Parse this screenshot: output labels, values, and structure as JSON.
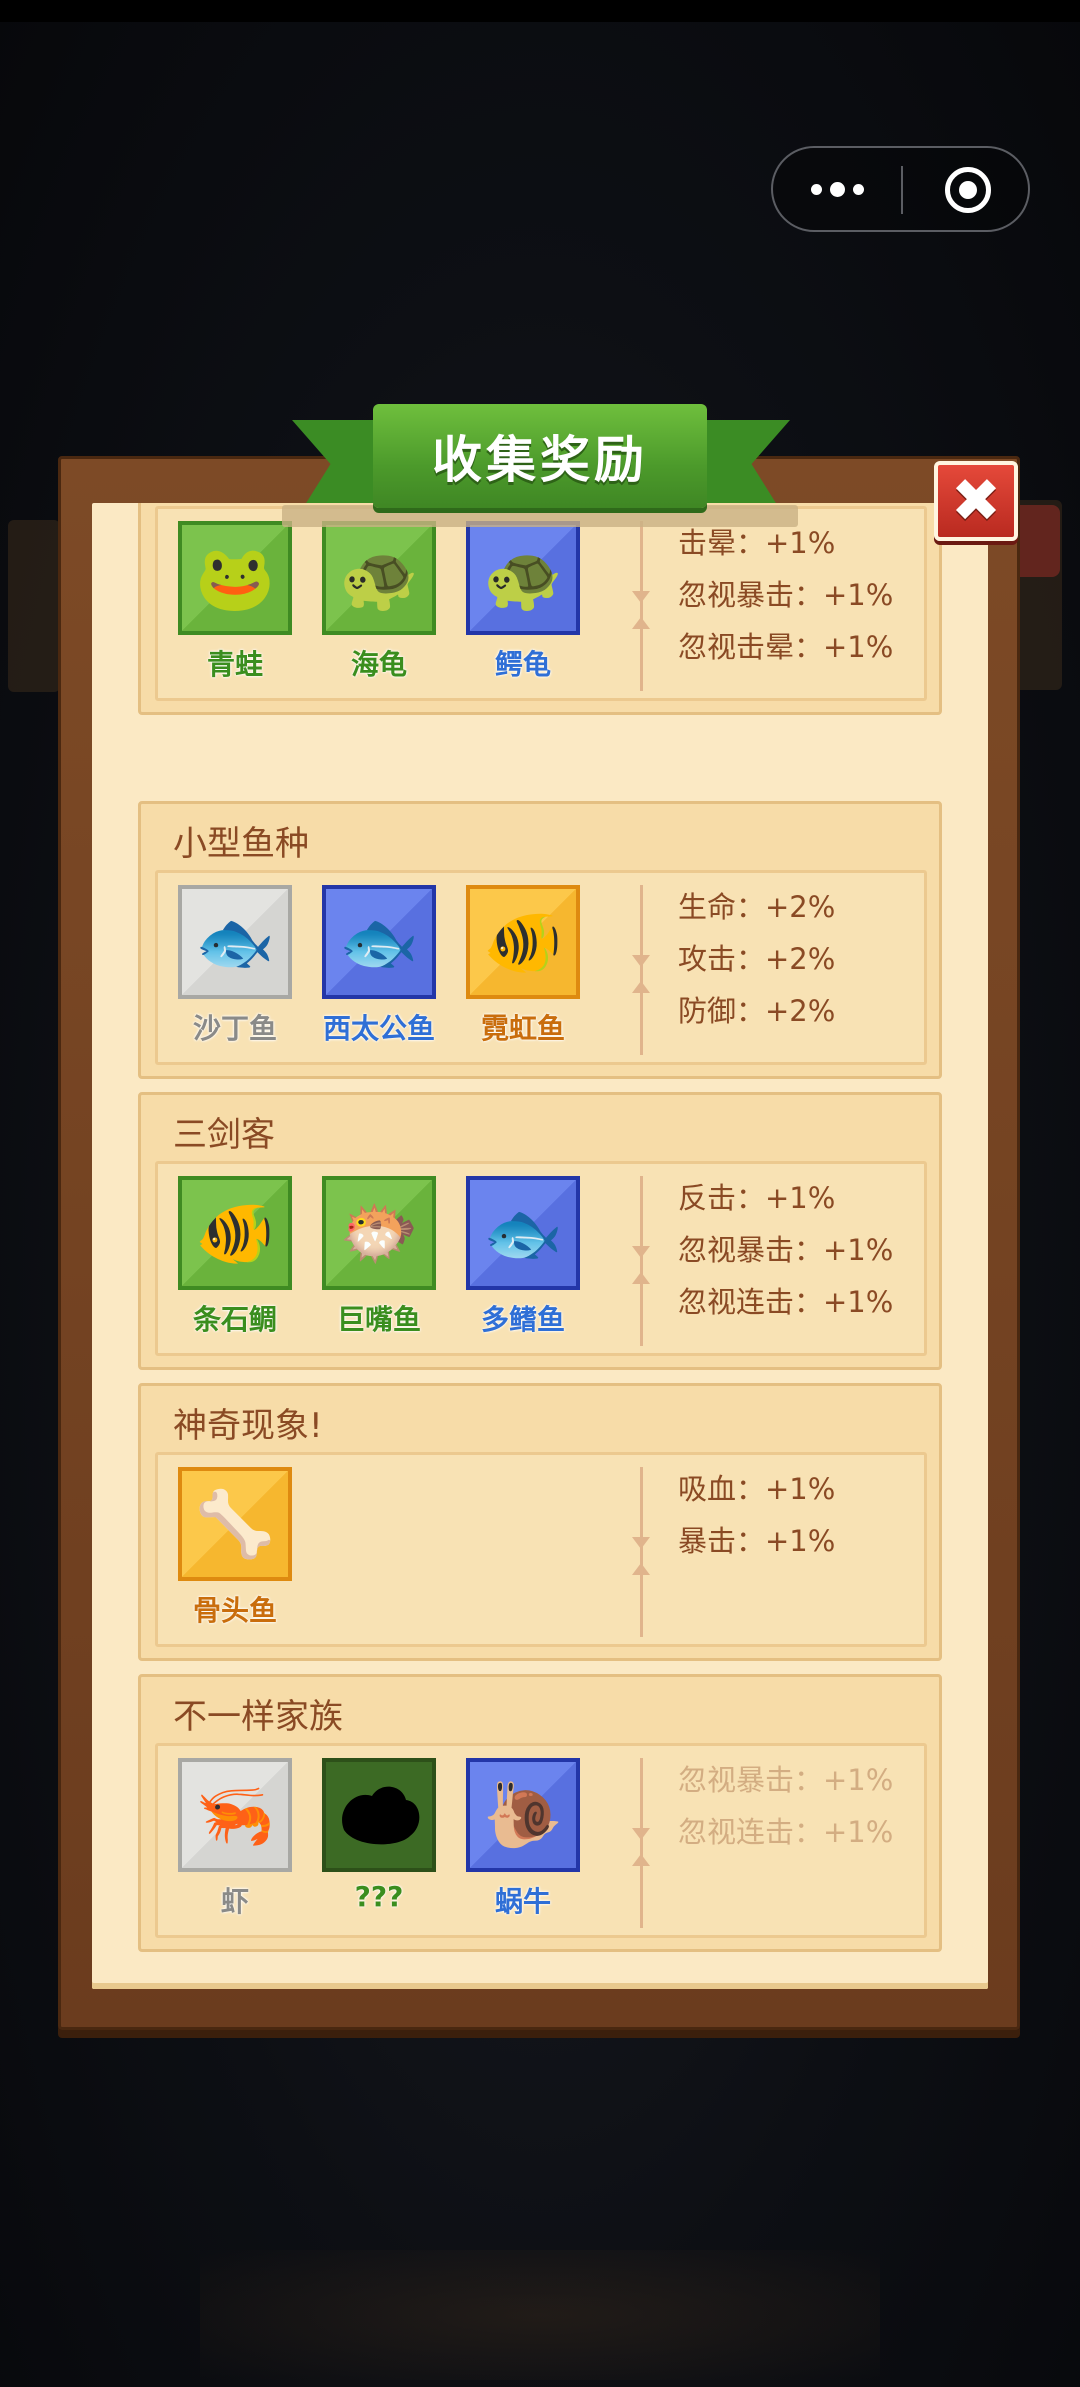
{
  "window": {
    "capsule_more": "more-dots",
    "capsule_close": "target-circle"
  },
  "panel": {
    "title": "收集奖励",
    "close_label": "✖"
  },
  "groups": [
    {
      "title": "",
      "items": [
        {
          "name": "青蛙",
          "rarity": "green",
          "icon": "frog-icon",
          "glyph": "🐸"
        },
        {
          "name": "海龟",
          "rarity": "green",
          "icon": "turtle-icon",
          "glyph": "🐢"
        },
        {
          "name": "鳄龟",
          "rarity": "blue",
          "icon": "snapping-turtle-icon",
          "glyph": "🐢"
        }
      ],
      "stats": [
        "击晕：+1%",
        "忽视暴击：+1%",
        "忽视击晕：+1%"
      ],
      "active": true
    },
    {
      "title": "小型鱼种",
      "items": [
        {
          "name": "沙丁鱼",
          "rarity": "gray",
          "icon": "sardine-icon",
          "glyph": "🐟"
        },
        {
          "name": "西太公鱼",
          "rarity": "blue",
          "icon": "smelt-icon",
          "glyph": "🐟"
        },
        {
          "name": "霓虹鱼",
          "rarity": "gold",
          "icon": "neon-fish-icon",
          "glyph": "🐠"
        }
      ],
      "stats": [
        "生命：+2%",
        "攻击：+2%",
        "防御：+2%"
      ],
      "active": true
    },
    {
      "title": "三剑客",
      "items": [
        {
          "name": "条石鲷",
          "rarity": "green",
          "icon": "striped-beakfish-icon",
          "glyph": "🐠"
        },
        {
          "name": "巨嘴鱼",
          "rarity": "green",
          "icon": "bigmouth-fish-icon",
          "glyph": "🐡"
        },
        {
          "name": "多鳍鱼",
          "rarity": "blue",
          "icon": "bichir-icon",
          "glyph": "🐟"
        }
      ],
      "stats": [
        "反击：+1%",
        "忽视暴击：+1%",
        "忽视连击：+1%"
      ],
      "active": true
    },
    {
      "title": "神奇现象!",
      "items": [
        {
          "name": "骨头鱼",
          "rarity": "gold",
          "icon": "bone-fish-icon",
          "glyph": "🦴"
        }
      ],
      "stats": [
        "吸血：+1%",
        "暴击：+1%"
      ],
      "active": true
    },
    {
      "title": "不一样家族",
      "items": [
        {
          "name": "虾",
          "rarity": "gray",
          "icon": "shrimp-icon",
          "glyph": "🦐"
        },
        {
          "name": "???",
          "rarity": "dark",
          "icon": "unknown-silhouette-icon",
          "glyph": ""
        },
        {
          "name": "蜗牛",
          "rarity": "blue",
          "icon": "snail-icon",
          "glyph": "🐌"
        }
      ],
      "stats": [
        "忽视暴击：+1%",
        "忽视连击：+1%"
      ],
      "active": false
    }
  ],
  "colors": {
    "panel_bg": "#fbe9c4",
    "frame": "#7d4a26",
    "ribbon": "#4c9a2b",
    "close": "#d23a2c",
    "stat_text": "#8a4a24",
    "stat_text_dim": "#d3ad82"
  }
}
